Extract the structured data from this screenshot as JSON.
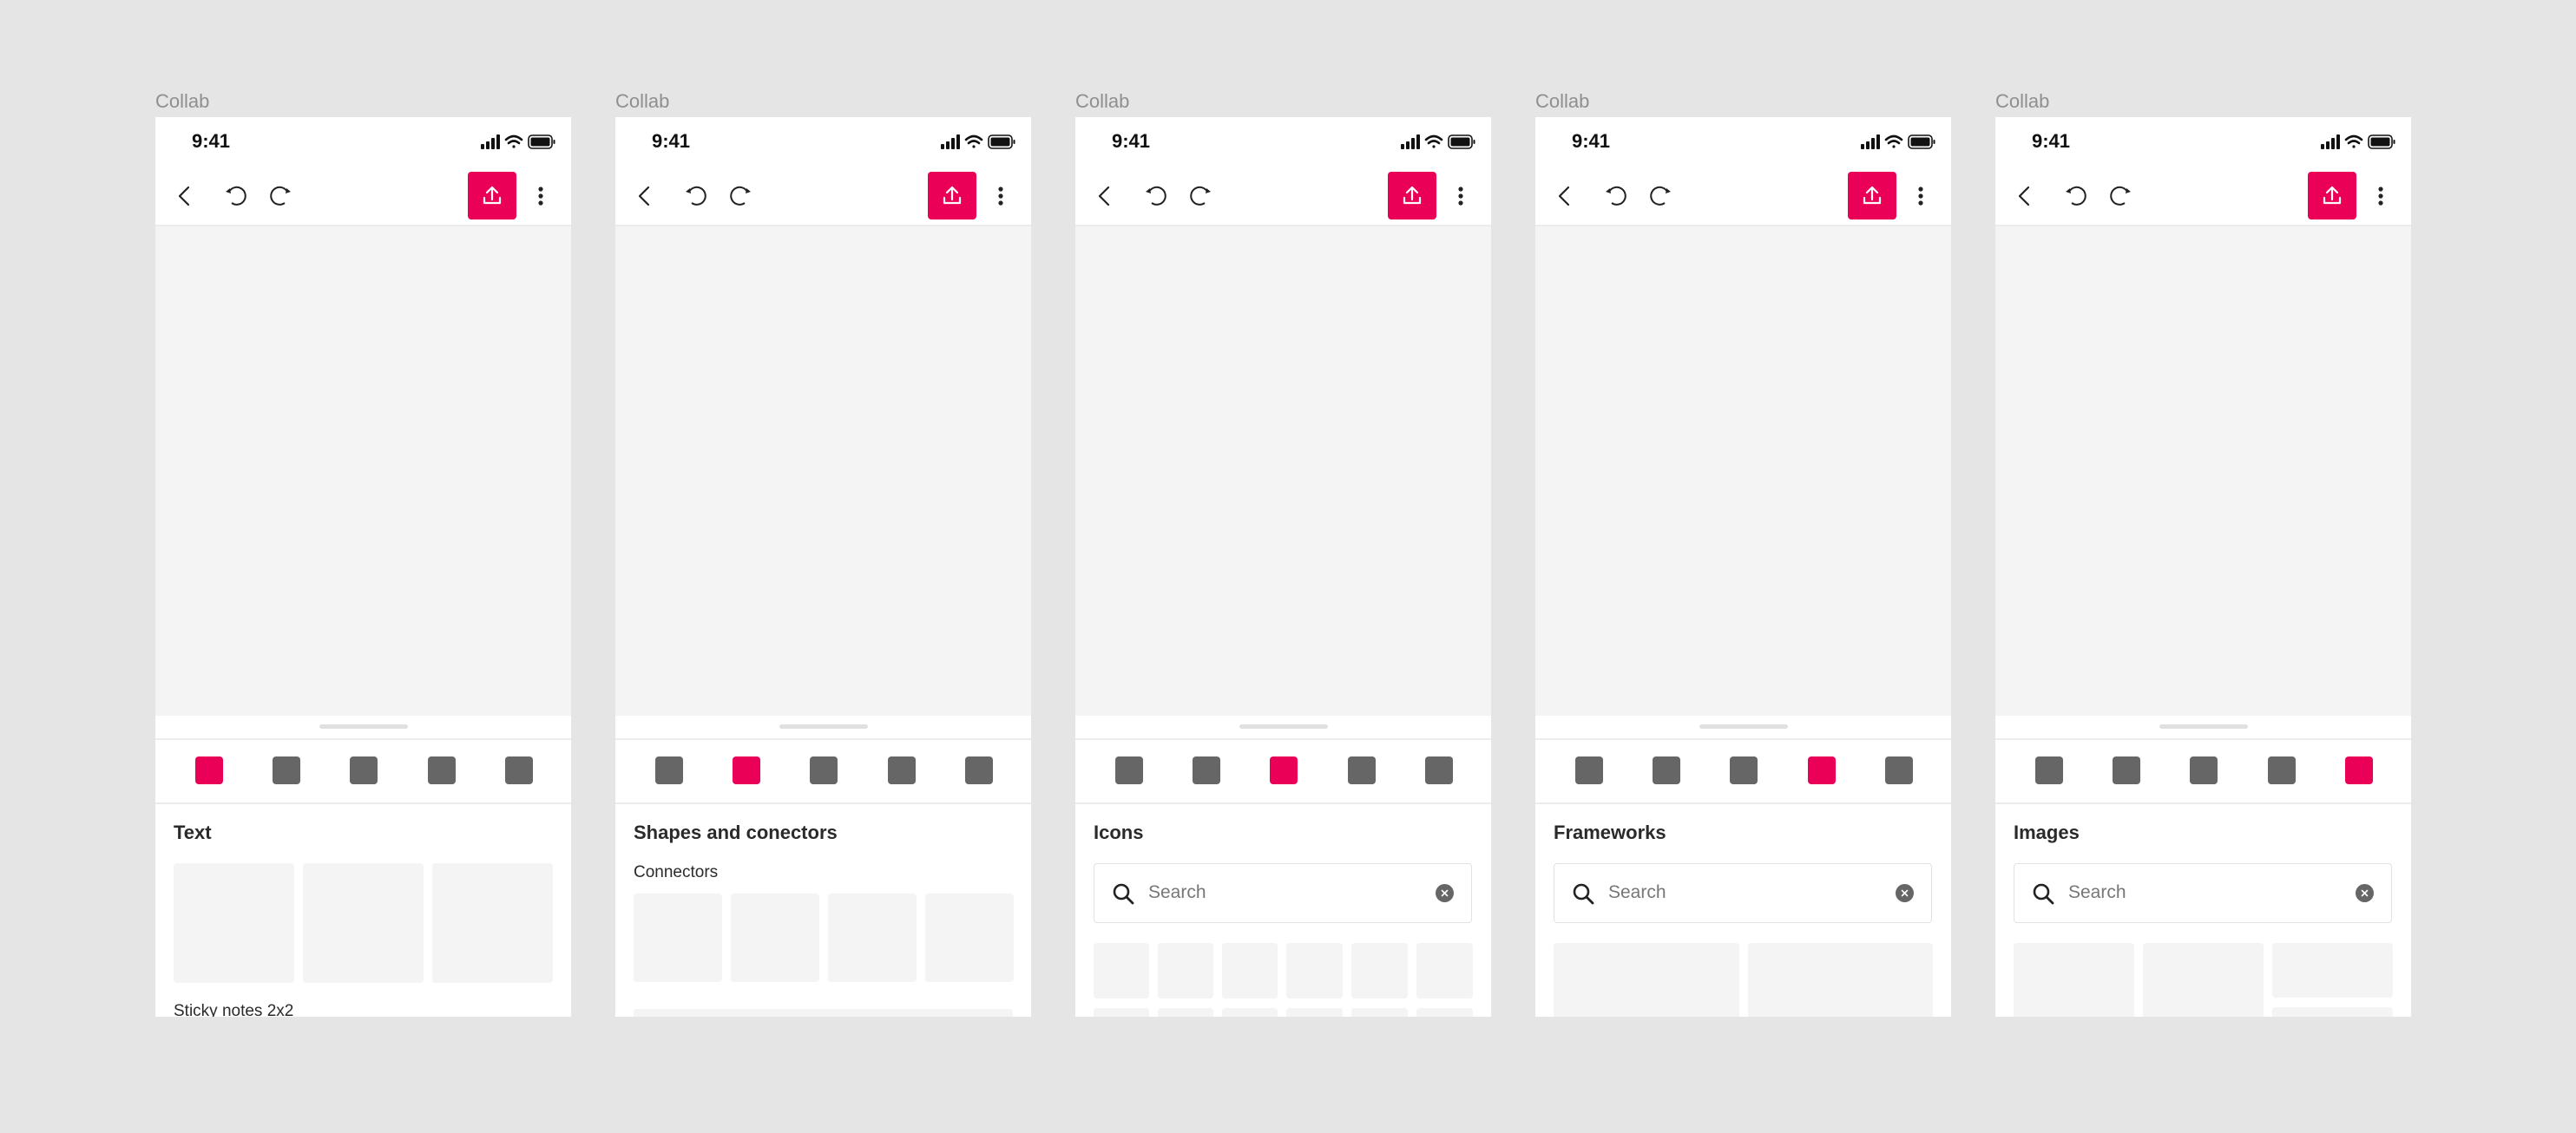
{
  "colors": {
    "accent": "#EB0058",
    "tab_inactive": "#666666",
    "canvas": "#F4F4F4",
    "background": "#E5E5E5"
  },
  "status_bar": {
    "time": "9:41",
    "icons": [
      "signal-icon",
      "wifi-icon",
      "battery-icon"
    ]
  },
  "toolbar": {
    "icons": [
      "back-icon",
      "undo-icon",
      "redo-icon",
      "share-upload-icon",
      "more-vertical-icon"
    ]
  },
  "frames": [
    {
      "label": "Collab",
      "active_tab": 0,
      "panel": {
        "title": "Text",
        "type": "text",
        "next_section": "Sticky notes 2x2"
      }
    },
    {
      "label": "Collab",
      "active_tab": 1,
      "panel": {
        "title": "Shapes and conectors",
        "type": "shapes",
        "subtitle": "Connectors"
      }
    },
    {
      "label": "Collab",
      "active_tab": 2,
      "panel": {
        "title": "Icons",
        "type": "icons",
        "search_placeholder": "Search"
      }
    },
    {
      "label": "Collab",
      "active_tab": 3,
      "panel": {
        "title": "Frameworks",
        "type": "frameworks",
        "search_placeholder": "Search"
      }
    },
    {
      "label": "Collab",
      "active_tab": 4,
      "panel": {
        "title": "Images",
        "type": "images",
        "search_placeholder": "Search"
      }
    }
  ]
}
